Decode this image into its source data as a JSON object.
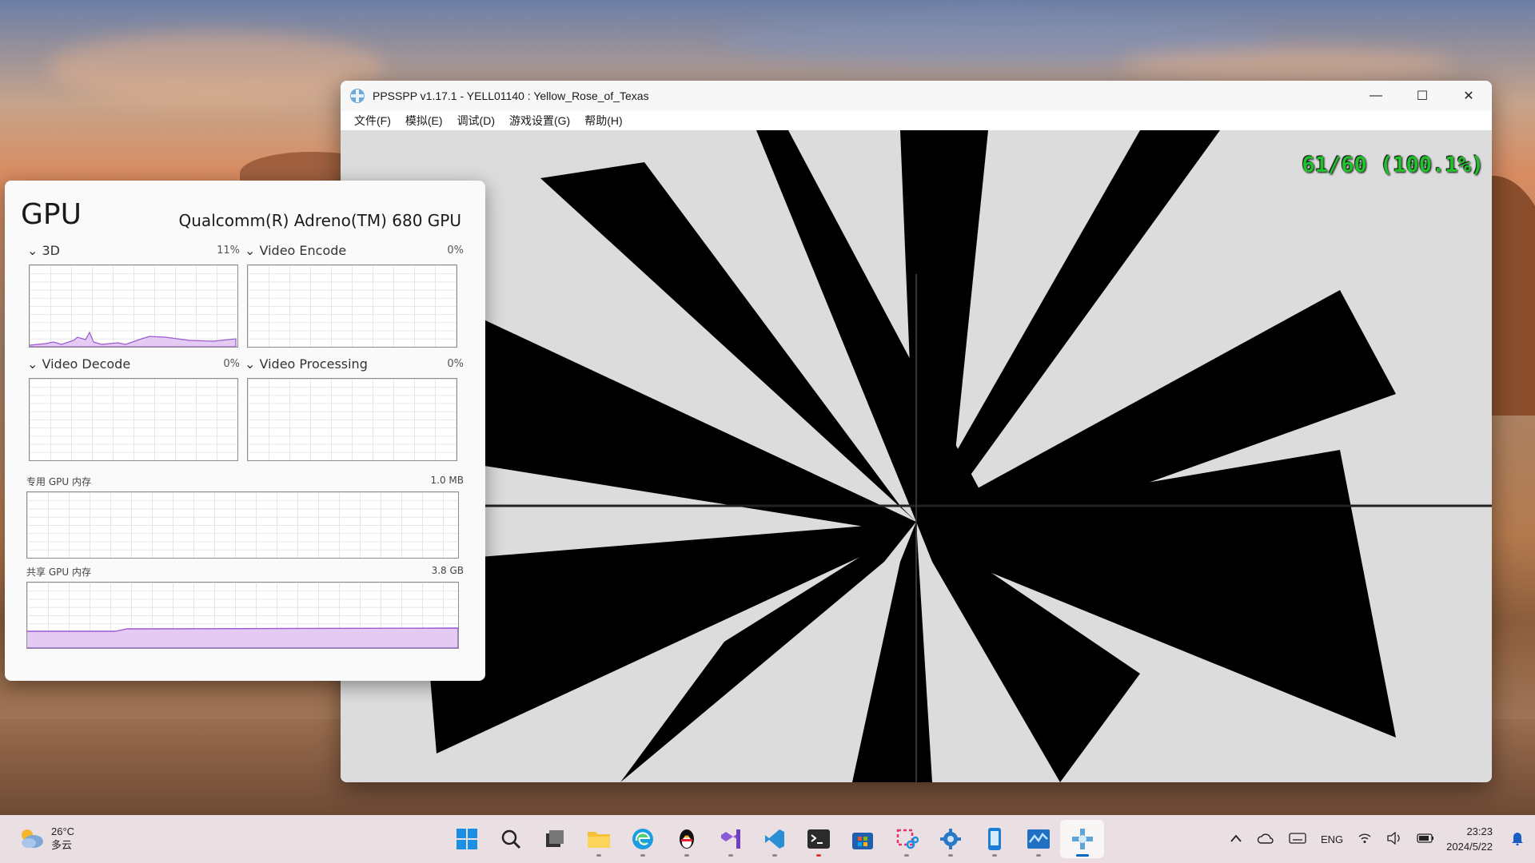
{
  "ppsspp": {
    "title": "PPSSPP v1.17.1 - YELL01140 : Yellow_Rose_of_Texas",
    "menu": [
      "文件(F)",
      "模拟(E)",
      "调试(D)",
      "游戏设置(G)",
      "帮助(H)"
    ],
    "fps": "61/60 (100.1%)",
    "minimize_symbol": "—",
    "maximize_symbol": "☐",
    "close_symbol": "✕"
  },
  "gpu_panel": {
    "title": "GPU",
    "model": "Qualcomm(R) Adreno(TM) 680 GPU",
    "engines": [
      {
        "label": "3D",
        "percent": "11%"
      },
      {
        "label": "Video Encode",
        "percent": "0%"
      },
      {
        "label": "Video Decode",
        "percent": "0%"
      },
      {
        "label": "Video Processing",
        "percent": "0%"
      }
    ],
    "dedicated_memory": {
      "label": "专用 GPU 内存",
      "value": "1.0 MB"
    },
    "shared_memory": {
      "label": "共享 GPU 内存",
      "value": "3.8 GB"
    },
    "graph_color": "#9b59d0"
  },
  "taskbar": {
    "weather": {
      "temp": "26°C",
      "condition": "多云"
    },
    "apps": [
      {
        "name": "start-button-icon",
        "running": false
      },
      {
        "name": "search-icon",
        "running": false
      },
      {
        "name": "task-view-icon",
        "running": false
      },
      {
        "name": "file-explorer-icon",
        "running": true
      },
      {
        "name": "edge-browser-icon",
        "running": true
      },
      {
        "name": "qq-icon",
        "running": true
      },
      {
        "name": "visual-studio-icon",
        "running": true
      },
      {
        "name": "vscode-icon",
        "running": true
      },
      {
        "name": "terminal-icon",
        "running": true
      },
      {
        "name": "microsoft-store-icon",
        "running": false
      },
      {
        "name": "snipping-tool-icon",
        "running": true
      },
      {
        "name": "gear-app-icon",
        "running": true
      },
      {
        "name": "phone-link-icon",
        "running": true
      },
      {
        "name": "task-manager-icon",
        "running": true
      },
      {
        "name": "ppsspp-icon",
        "running": true
      }
    ],
    "tray": {
      "language": "ENG",
      "time": "23:23",
      "date": "2024/5/22"
    }
  }
}
